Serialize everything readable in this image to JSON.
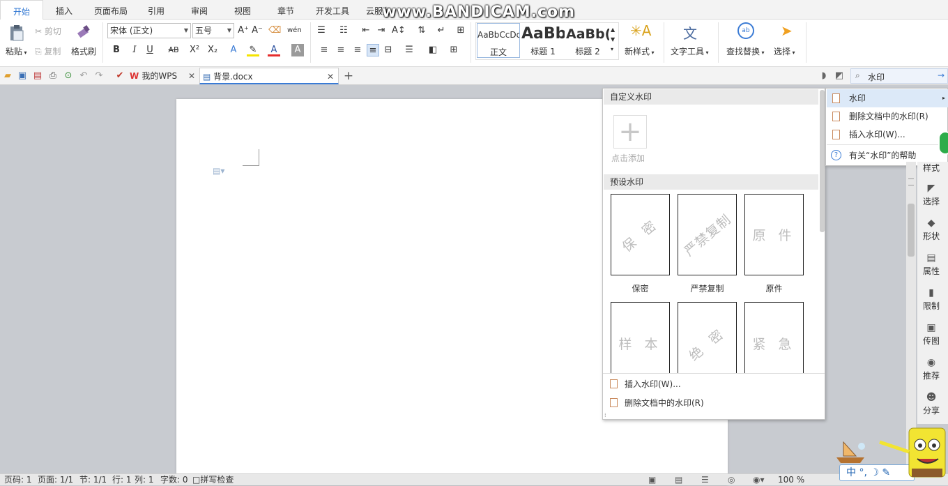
{
  "menu_tabs": [
    "开始",
    "插入",
    "页面布局",
    "引用",
    "审阅",
    "视图",
    "章节",
    "开发工具",
    "云服务"
  ],
  "watermark_overlay": "www.BANDICAM.com",
  "ribbon": {
    "paste": "粘贴",
    "cut": "剪切",
    "copy": "复制",
    "format_painter": "格式刷",
    "font_name": "宋体 (正文)",
    "font_size": "五号",
    "styles": [
      {
        "sample": "AaBbCcDd",
        "label": "正文"
      },
      {
        "sample": "AaBb",
        "label": "标题 1"
      },
      {
        "sample": "AaBb(",
        "label": "标题 2"
      }
    ],
    "new_style": "新样式",
    "text_tools": "文字工具",
    "find_replace": "查找替换",
    "select": "选择",
    "bold": "B",
    "italic": "I",
    "underline": "U",
    "strike": "AB",
    "superscript": "X²",
    "subscript": "X₂"
  },
  "doc_tabs": [
    {
      "label": "我的WPS"
    },
    {
      "label": "背景.docx"
    }
  ],
  "search": {
    "value": "水印"
  },
  "watermark_panel": {
    "custom_header": "自定义水印",
    "add_label": "点击添加",
    "preset_header": "预设水印",
    "presets": [
      {
        "text": "保 密",
        "label": "保密"
      },
      {
        "text": "严禁复制",
        "label": "严禁复制"
      },
      {
        "text": "原 件",
        "label": "原件"
      },
      {
        "text": "样 本",
        "label": ""
      },
      {
        "text": "绝 密",
        "label": ""
      },
      {
        "text": "紧 急",
        "label": ""
      }
    ],
    "insert": "插入水印(W)...",
    "remove": "删除文档中的水印(R)"
  },
  "submenu": {
    "items": [
      "水印",
      "删除文档中的水印(R)",
      "插入水印(W)...",
      "有关“水印”的帮助"
    ]
  },
  "sidebar": {
    "items": [
      "样式",
      "选择",
      "形状",
      "属性",
      "限制",
      "传图",
      "推荐",
      "分享"
    ]
  },
  "status": {
    "page": "页码: 1",
    "pages": "页面: 1/1",
    "section": "节: 1/1",
    "row": "行: 1",
    "col": "列: 1",
    "words": "字数: 0",
    "spell": "拼写检查",
    "zoom": "100 %"
  },
  "ime": {
    "text": "中 °, ☽ ✎"
  }
}
